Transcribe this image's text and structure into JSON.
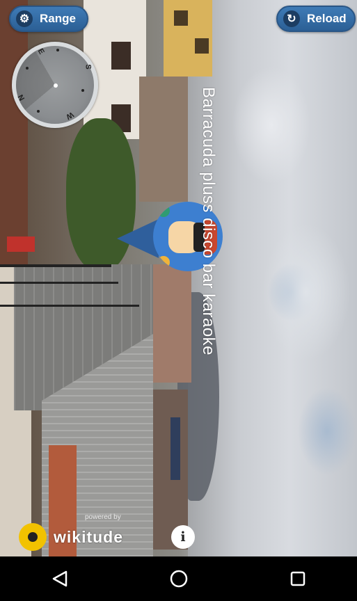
{
  "toolbar": {
    "range_label": "Range",
    "range_icon": "gear-icon",
    "reload_label": "Reload",
    "reload_icon": "refresh-icon"
  },
  "radar": {
    "directions": [
      "N",
      "E",
      "S",
      "W"
    ]
  },
  "poi": {
    "name": "Barracuda pluss disco bar karaoke"
  },
  "branding": {
    "powered_by": "powered by",
    "brand": "wikitude",
    "info_icon": "i"
  },
  "nav": {
    "back": "back-icon",
    "home": "home-icon",
    "recents": "recents-icon"
  },
  "colors": {
    "button_blue": "#2b5f95",
    "marker_blue": "#3d7fd0",
    "wikitude_yellow": "#f2c200"
  }
}
